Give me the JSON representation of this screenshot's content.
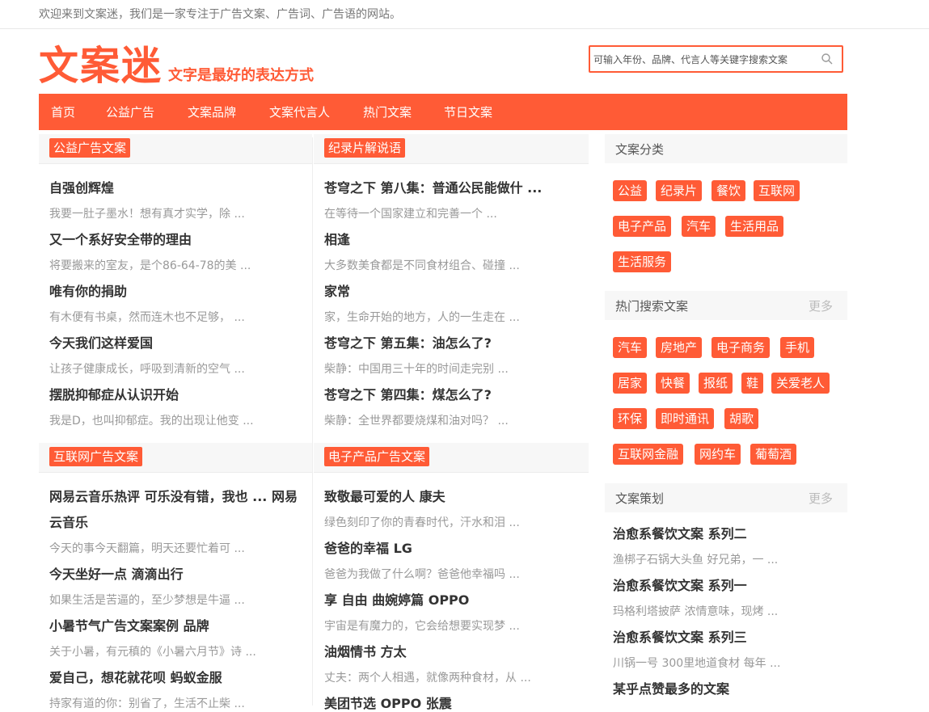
{
  "topbar": {
    "welcome": "欢迎来到文案迷，我们是一家专注于广告文案、广告词、广告语的网站。"
  },
  "header": {
    "logo": "文案迷",
    "slogan": "文字是最好的表达方式",
    "search_placeholder": "可输入年份、品牌、代言人等关键字搜索文案"
  },
  "nav": [
    "首页",
    "公益广告",
    "文案品牌",
    "文案代言人",
    "热门文案",
    "节日文案"
  ],
  "sections": [
    {
      "title": "公益广告文案",
      "items": [
        {
          "title": "自强创辉煌",
          "desc": "我要一肚子墨水！想有真才实学，除 ..."
        },
        {
          "title": "又一个系好安全带的理由",
          "desc": "将要搬来的室友，是个86-64-78的美 ..."
        },
        {
          "title": "唯有你的捐助",
          "desc": "有木便有书桌，然而连木也不足够， ..."
        },
        {
          "title": "今天我们这样爱国",
          "desc": "让孩子健康成长，呼吸到清新的空气 ..."
        },
        {
          "title": "摆脱抑郁症从认识开始",
          "desc": "我是D，也叫抑郁症。我的出现让他变 ..."
        }
      ]
    },
    {
      "title": "纪录片解说语",
      "items": [
        {
          "title": "苍穹之下 第八集：普通公民能做什 ...",
          "desc": "在等待一个国家建立和完善一个 ..."
        },
        {
          "title": "相逢",
          "desc": "大多数美食都是不同食材组合、碰撞 ..."
        },
        {
          "title": "家常",
          "desc": "家，生命开始的地方，人的一生走在 ..."
        },
        {
          "title": "苍穹之下 第五集：油怎么了?",
          "desc": "柴静：中国用三十年的时间走完别 ..."
        },
        {
          "title": "苍穹之下 第四集：煤怎么了?",
          "desc": "柴静：全世界都要烧煤和油对吗？ ..."
        }
      ]
    },
    {
      "title": "互联网广告文案",
      "items": [
        {
          "title": "网易云音乐热评 可乐没有错，我也 ... 网易",
          "title2": "云音乐",
          "desc": "今天的事今天翻篇，明天还要忙着可 ..."
        },
        {
          "title": "今天坐好一点 滴滴出行",
          "desc": "如果生活是苦逼的，至少梦想是牛逼 ..."
        },
        {
          "title": "小暑节气广告文案案例 品牌",
          "desc": "关于小暑，有元稹的《小暑六月节》诗 ..."
        },
        {
          "title": "爱自己，想花就花呗 蚂蚁金服",
          "desc": "持家有道的你：别省了，生活不止柴 ..."
        }
      ]
    },
    {
      "title": "电子产品广告文案",
      "items": [
        {
          "title": "致敬最可爱的人 康夫",
          "desc": "绿色刻印了你的青春时代，汗水和泪 ..."
        },
        {
          "title": "爸爸的幸福 LG",
          "desc": "爸爸为我做了什么啊？爸爸他幸福吗 ..."
        },
        {
          "title": "享 自由 曲婉婷篇 OPPO",
          "desc": "宇宙是有魔力的，它会给想要实现梦 ..."
        },
        {
          "title": "油烟情书 方太",
          "desc": "丈夫：两个人相遇，就像两种食材，从 ..."
        },
        {
          "title": "美团节选 OPPO 张震",
          "desc": ""
        }
      ]
    }
  ],
  "sidebar": {
    "categories": {
      "title": "文案分类",
      "tags": [
        "公益",
        "纪录片",
        "餐饮",
        "互联网",
        "电子产品",
        "汽车",
        "生活用品",
        "生活服务"
      ]
    },
    "hot": {
      "title": "热门搜索文案",
      "more": "更多",
      "tags": [
        "汽车",
        "房地产",
        "电子商务",
        "手机",
        "居家",
        "快餐",
        "报纸",
        "鞋",
        "关爱老人",
        "环保",
        "即时通讯",
        "胡歌",
        "互联网金融",
        "网约车",
        "葡萄酒"
      ]
    },
    "planning": {
      "title": "文案策划",
      "more": "更多",
      "items": [
        {
          "title": "治愈系餐饮文案 系列二",
          "desc": "渔梆子石锅大头鱼 好兄弟，一 ..."
        },
        {
          "title": "治愈系餐饮文案 系列一",
          "desc": "玛格利塔披萨 浓情意味，现烤 ..."
        },
        {
          "title": "治愈系餐饮文案 系列三",
          "desc": "川锅一号 300里地道食材 每年 ..."
        },
        {
          "title": "某乎点赞最多的文案",
          "desc": ""
        }
      ]
    }
  },
  "colors": {
    "accent": "#ff5b36",
    "muted": "#999999",
    "text": "#333333",
    "panel": "#f7f7f7"
  },
  "icons": {
    "search": "search-icon"
  }
}
